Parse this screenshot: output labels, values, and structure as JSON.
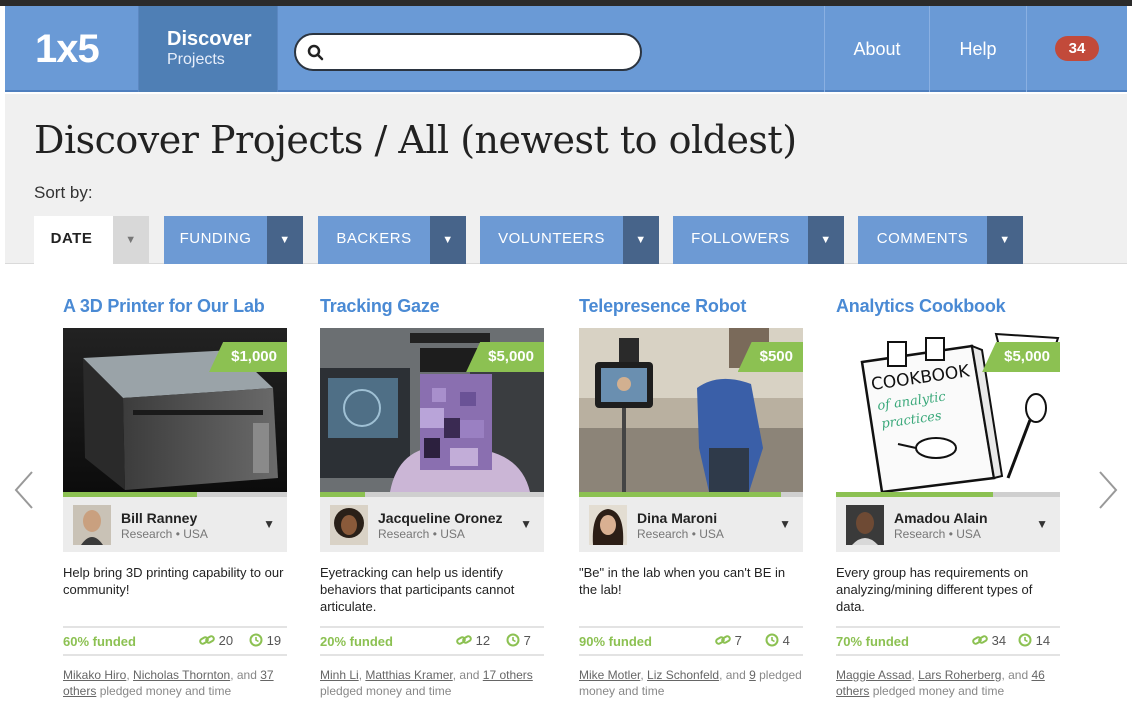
{
  "header": {
    "logo": "1x5",
    "discover_title": "Discover",
    "discover_subtitle": "Projects",
    "search": {
      "value": "",
      "placeholder": ""
    },
    "about": "About",
    "help": "Help",
    "notifications_count": "34"
  },
  "page": {
    "title": "Discover Projects / All (newest to oldest)",
    "sort_by": "Sort by:",
    "sort_options": [
      {
        "label": "DATE"
      },
      {
        "label": "FUNDING"
      },
      {
        "label": "BACKERS"
      },
      {
        "label": "VOLUNTEERS"
      },
      {
        "label": "FOLLOWERS"
      },
      {
        "label": "COMMENTS"
      }
    ]
  },
  "cards": [
    {
      "title": "A 3D Printer for Our Lab",
      "price": "$1,000",
      "owner": "Bill Ranney",
      "meta": "Research • USA",
      "description": "Help bring 3D printing capability to our community!",
      "funded": "60% funded",
      "progress": 0.6,
      "links": "20",
      "time": "19",
      "backer1": "Mikako Hiro",
      "sep1": ", ",
      "backer2": "Nicholas Thornton",
      "sep2": ", and ",
      "backer3": "37 others",
      "tail": " pledged money and time"
    },
    {
      "title": "Tracking Gaze",
      "price": "$5,000",
      "owner": "Jacqueline Oronez",
      "meta": "Research • USA",
      "description": "Eyetracking can help us identify behaviors that participants cannot articulate.",
      "funded": "20% funded",
      "progress": 0.2,
      "links": "12",
      "time": "7",
      "backer1": "Minh Li",
      "sep1": ", ",
      "backer2": "Matthias Kramer",
      "sep2": ", and ",
      "backer3": "17 others",
      "tail": " pledged money and time"
    },
    {
      "title": "Telepresence Robot",
      "price": "$500",
      "owner": "Dina Maroni",
      "meta": "Research • USA",
      "description": "\"Be\" in the lab when you can't BE in the lab!",
      "funded": "90% funded",
      "progress": 0.9,
      "links": "7",
      "time": "4",
      "backer1": "Mike Motler",
      "sep1": ", ",
      "backer2": "Liz Schonfeld",
      "sep2": ", and ",
      "backer3": "9",
      "tail": " pledged money and time"
    },
    {
      "title": "Analytics Cookbook",
      "price": "$5,000",
      "owner": "Amadou Alain",
      "meta": "Research • USA",
      "description": "Every group has requirements on analyzing/mining different types of data.",
      "funded": "70% funded",
      "progress": 0.7,
      "links": "34",
      "time": "14",
      "backer1": "Maggie Assad",
      "sep1": ", ",
      "backer2": "Lars Roherberg",
      "sep2": ", and ",
      "backer3": "46 others",
      "tail": " pledged money and time",
      "cookbook_line1": "COOKBOOK",
      "cookbook_line2": "of analytic",
      "cookbook_line3": "practices"
    }
  ],
  "colors": {
    "nav": "#6a9ad6",
    "accent": "#8cc152",
    "title_blue": "#4a8ad4",
    "badge": "#c24a3a"
  }
}
